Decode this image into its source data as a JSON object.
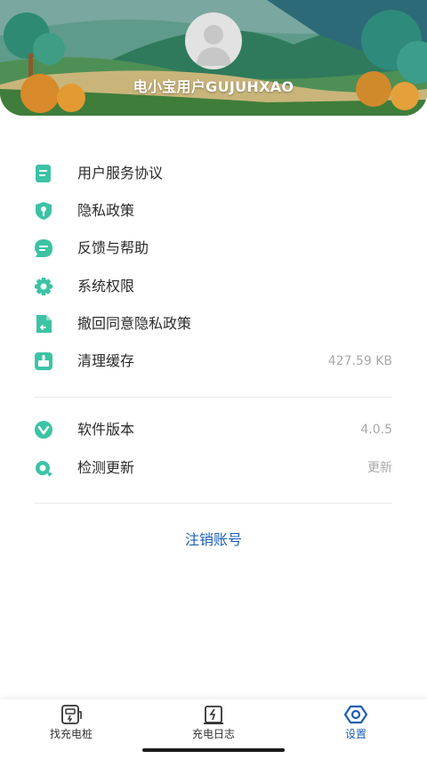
{
  "profile": {
    "username": "电小宝用户GUJUHXAO"
  },
  "menu_group_1": [
    {
      "label": "用户服务协议",
      "icon": "document-icon",
      "value": ""
    },
    {
      "label": "隐私政策",
      "icon": "privacy-shield-icon",
      "value": ""
    },
    {
      "label": "反馈与帮助",
      "icon": "chat-bubble-icon",
      "value": ""
    },
    {
      "label": "系统权限",
      "icon": "gear-icon",
      "value": ""
    },
    {
      "label": "撤回同意隐私政策",
      "icon": "revoke-file-icon",
      "value": ""
    },
    {
      "label": "清理缓存",
      "icon": "broom-icon",
      "value": "427.59 KB"
    }
  ],
  "menu_group_2": [
    {
      "label": "软件版本",
      "icon": "version-v-icon",
      "value": "4.0.5"
    },
    {
      "label": "检测更新",
      "icon": "refresh-icon",
      "value": "更新"
    }
  ],
  "logout_label": "注销账号",
  "tabs": [
    {
      "label": "找充电桩",
      "icon": "charger-icon",
      "active": false
    },
    {
      "label": "充电日志",
      "icon": "charge-log-icon",
      "active": false
    },
    {
      "label": "设置",
      "icon": "settings-hex-icon",
      "active": true
    }
  ],
  "colors": {
    "icon_teal": "#3cc3a4",
    "link_blue": "#1d5fb3",
    "value_gray": "#a9a9a9"
  }
}
